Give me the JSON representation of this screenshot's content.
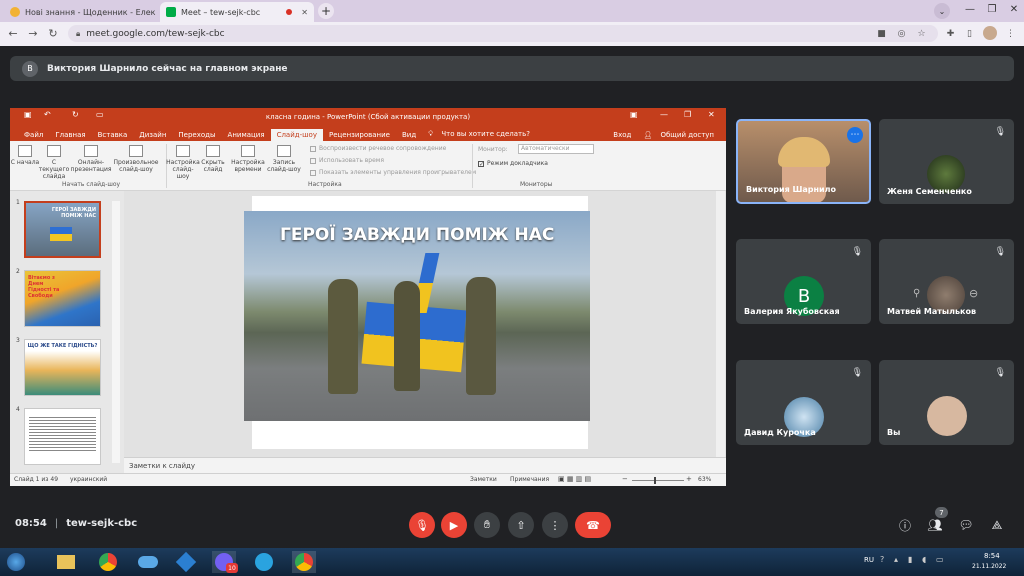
{
  "browser": {
    "tabs": [
      {
        "title": "Нові знання - Щоденник - Елек"
      },
      {
        "title": "Meet – tew-sejk-cbc"
      }
    ],
    "url": "meet.google.com/tew-sejk-cbc"
  },
  "banner": {
    "text": "Виктория Шарнило сейчас на главном экране",
    "avatar_letter": "В"
  },
  "ppt": {
    "title": "класна година - PowerPoint (Сбой активации продукта)",
    "tabs": [
      "Файл",
      "Главная",
      "Вставка",
      "Дизайн",
      "Переходы",
      "Анимация",
      "Слайд-шоу",
      "Рецензирование",
      "Вид"
    ],
    "tell_me": "Что вы хотите сделать?",
    "login": "Вход",
    "share": "Общий доступ",
    "ribbon": {
      "btn_from_start": "С начала",
      "btn_from_current": "С текущего слайда",
      "btn_online": "Онлайн-презентация",
      "btn_custom": "Произвольное слайд-шоу",
      "btn_setup": "Настройка слайд-шоу",
      "btn_hide": "Скрыть слайд",
      "btn_timings": "Настройка времени",
      "btn_record": "Запись слайд-шоу",
      "group_start": "Начать слайд-шоу",
      "group_setup": "Настройка",
      "group_monitors": "Мониторы",
      "chk_narration": "Воспроизвести речевое сопровождение",
      "chk_timings": "Использовать время",
      "chk_controls": "Показать элементы управления проигрывателем",
      "monitor_label": "Монитор:",
      "monitor_value": "Автоматически",
      "presenter_view": "Режим докладчика"
    },
    "thumb_numbers": [
      "1",
      "2",
      "3",
      "4"
    ],
    "thumb1_title": "ГЕРОЇ ЗАВЖДИ ПОМІЖ НАС",
    "thumb2_title": "Вітаємо з Днем Гідності та Свободи",
    "thumb3_title": "ЩО ЖЕ ТАКЕ ГІДНІСТЬ?",
    "slide_title": "ГЕРОЇ ЗАВЖДИ ПОМІЖ НАС",
    "notes": "Заметки к слайду",
    "status": {
      "slide_count": "Слайд 1 из 49",
      "language": "украинский",
      "notes_btn": "Заметки",
      "comments_btn": "Примечания",
      "zoom": "63%"
    }
  },
  "participants": [
    {
      "name": "Виктория Шарнило"
    },
    {
      "name": "Женя Семенченко"
    },
    {
      "name": "Валерия Якубовская",
      "letter": "В"
    },
    {
      "name": "Матвей Матыльков"
    },
    {
      "name": "Давид Курочка"
    },
    {
      "name": "Вы"
    }
  ],
  "meet_bar": {
    "time": "08:54",
    "separator": "|",
    "code": "tew-sejk-cbc",
    "people_count": "7"
  },
  "taskbar": {
    "lang": "RU",
    "time": "8:54",
    "date": "21.11.2022",
    "viber_badge": "10"
  },
  "colors": {
    "ppt_accent": "#c43e1c",
    "meet_red": "#ea4335",
    "meet_bg": "#202124",
    "tile_bg": "#3c4043"
  }
}
